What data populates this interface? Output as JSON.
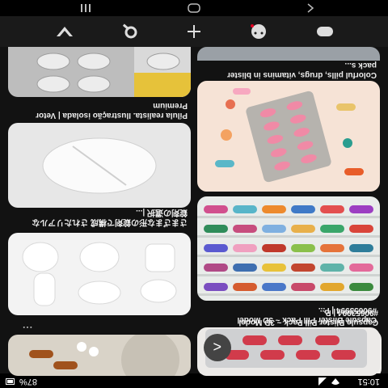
{
  "status": {
    "time": "10:51",
    "battery": "87%"
  },
  "cards": {
    "right": [
      {
        "caption": "Capsule Blister Pill Pack ~ 3D Model #90653994 | P..."
      },
      {
        "caption": ""
      },
      {
        "caption": "Colorful pills, drugs, vitamins in blister pack s..."
      }
    ],
    "left": [
      {
        "caption": ""
      },
      {
        "caption": "さまざまな形の錠剤で構成 されたリアルな錠剤の選択 |..."
      },
      {
        "caption": "Pílula realista. Ilustração isolada | Vetor Premium"
      }
    ]
  },
  "more_label": "...",
  "next_symbol": ">",
  "icons": [
    "compass-icon",
    "search-icon",
    "add-icon",
    "smiley-icon",
    "profile-icon"
  ],
  "nav": [
    "back",
    "home",
    "recent"
  ],
  "colors": {
    "accent": "#e60023",
    "bg": "#121212"
  }
}
